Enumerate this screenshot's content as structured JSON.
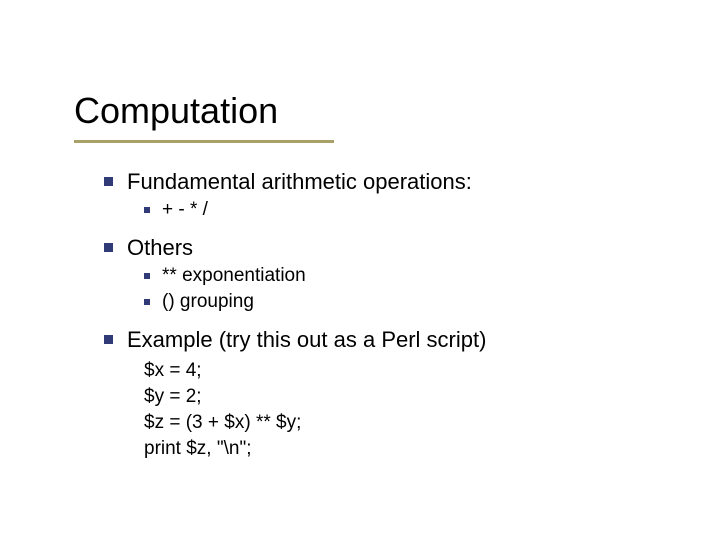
{
  "title": "Computation",
  "items": [
    {
      "label": "Fundamental arithmetic operations:",
      "sub": [
        {
          "label": "+ - * /"
        }
      ]
    },
    {
      "label": "Others",
      "sub": [
        {
          "label": "** exponentiation"
        },
        {
          "label": "() grouping"
        }
      ]
    },
    {
      "label": "Example (try this out as a Perl script)",
      "code": [
        "$x = 4;",
        "$y = 2;",
        "$z = (3 + $x) ** $y;",
        "print $z, \"\\n\";"
      ]
    }
  ]
}
